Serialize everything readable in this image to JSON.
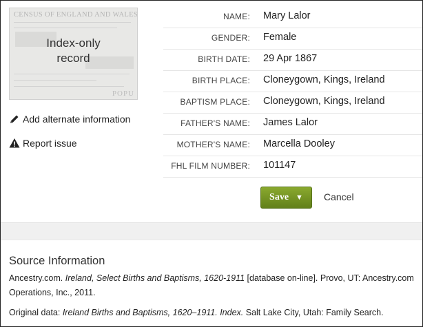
{
  "thumbnail": {
    "header_text": "CENSUS OF ENGLAND AND WALES",
    "footer_text": "POPU",
    "label_line1": "Index-only",
    "label_line2": "record"
  },
  "actions": {
    "add_alternate": "Add alternate information",
    "report_issue": "Report issue"
  },
  "fields": [
    {
      "label": "NAME:",
      "value": "Mary Lalor"
    },
    {
      "label": "GENDER:",
      "value": "Female"
    },
    {
      "label": "BIRTH DATE:",
      "value": "29 Apr 1867"
    },
    {
      "label": "BIRTH PLACE:",
      "value": "Cloneygown, Kings, Ireland"
    },
    {
      "label": "BAPTISM PLACE:",
      "value": "Cloneygown, Kings, Ireland"
    },
    {
      "label": "FATHER'S NAME:",
      "value": "James Lalor"
    },
    {
      "label": "MOTHER'S NAME:",
      "value": "Marcella Dooley"
    },
    {
      "label": "FHL FILM NUMBER:",
      "value": "101147"
    }
  ],
  "buttons": {
    "save": "Save",
    "cancel": "Cancel"
  },
  "source": {
    "title": "Source Information",
    "p1_a": "Ancestry.com. ",
    "p1_b": "Ireland, Select Births and Baptisms, 1620-1911",
    "p1_c": " [database on-line]. Provo, UT: Ancestry.com Operations, Inc., 2011.",
    "p2_a": "Original data: ",
    "p2_b": "Ireland Births and Baptisms, 1620–1911. Index.",
    "p2_c": " Salt Lake City, Utah: Family Search."
  },
  "colors": {
    "save_button": "#6f8c22",
    "divider": "#f0f0f0"
  }
}
